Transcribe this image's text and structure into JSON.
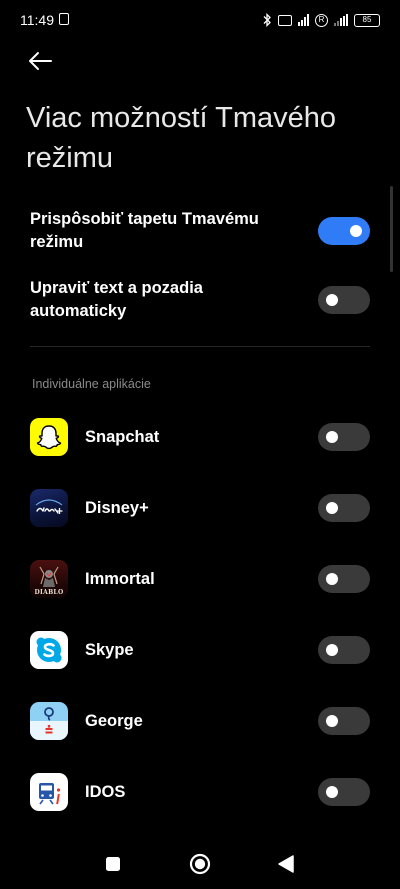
{
  "status_bar": {
    "time": "11:49",
    "battery": "85",
    "registered_icon": "R",
    "icons": [
      "sim-icon",
      "bluetooth-icon",
      "volte-icon",
      "signal-4g-icon",
      "registered-icon",
      "signal-icon",
      "battery-icon"
    ]
  },
  "header": {
    "back_icon": "arrow-left-icon",
    "title": "Viac možností Tmavého režimu"
  },
  "settings": {
    "wallpaper": {
      "label": "Prispôsobiť tapetu Tmavému režimu",
      "enabled": true
    },
    "auto_text": {
      "label": "Upraviť text a pozadia automaticky",
      "enabled": false
    }
  },
  "section": {
    "label": "Individuálne aplikácie"
  },
  "apps": [
    {
      "name": "Snapchat",
      "icon": "snapchat-icon",
      "enabled": false
    },
    {
      "name": "Disney+",
      "icon": "disney-plus-icon",
      "enabled": false
    },
    {
      "name": "Immortal",
      "icon": "diablo-immortal-icon",
      "enabled": false,
      "icon_text": "DIABLO"
    },
    {
      "name": "Skype",
      "icon": "skype-icon",
      "enabled": false
    },
    {
      "name": "George",
      "icon": "george-icon",
      "enabled": false
    },
    {
      "name": "IDOS",
      "icon": "idos-icon",
      "enabled": false
    }
  ],
  "nav": {
    "recents_icon": "square-icon",
    "home_icon": "circle-icon",
    "back_icon": "triangle-back-icon"
  },
  "colors": {
    "background": "#000000",
    "toggle_on": "#2f7cf6",
    "toggle_off": "#3a3a3a",
    "section_text": "#8a8a8a"
  }
}
